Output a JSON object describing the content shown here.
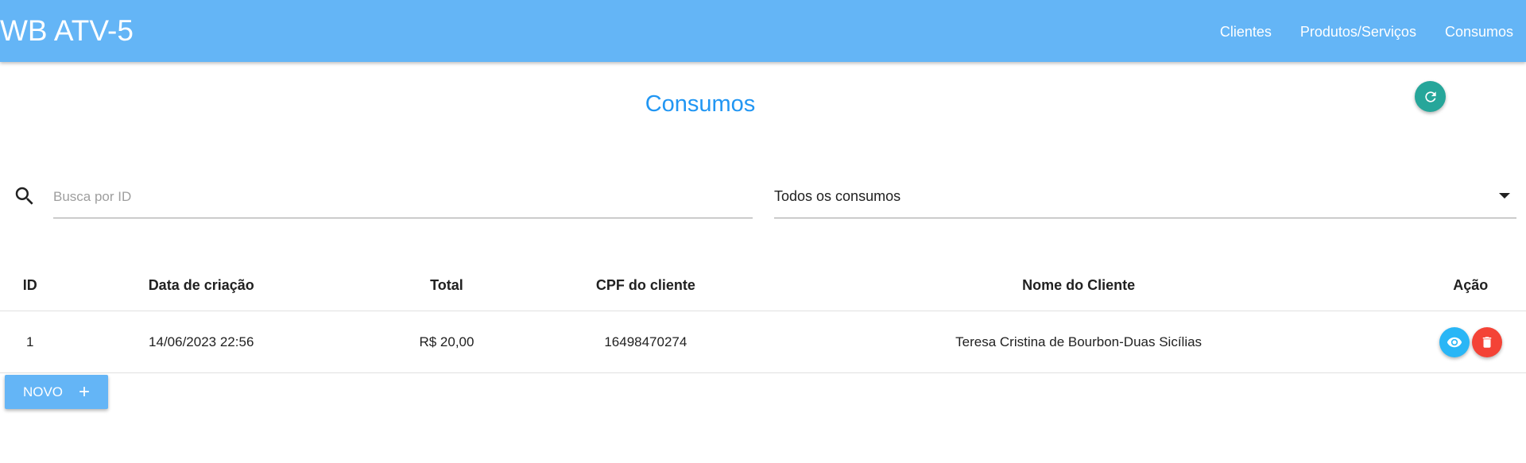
{
  "app": {
    "title": "WB ATV-5"
  },
  "nav": {
    "items": [
      {
        "label": "Clientes"
      },
      {
        "label": "Produtos/Serviços"
      },
      {
        "label": "Consumos"
      }
    ]
  },
  "page": {
    "title": "Consumos"
  },
  "search": {
    "placeholder": "Busca por ID",
    "value": ""
  },
  "filter": {
    "selected": "Todos os consumos"
  },
  "table": {
    "columns": [
      "ID",
      "Data de criação",
      "Total",
      "CPF do cliente",
      "Nome do Cliente",
      "Ação"
    ],
    "rows": [
      {
        "id": "1",
        "date": "14/06/2023 22:56",
        "total": "R$ 20,00",
        "cpf": "16498470274",
        "name": "Teresa Cristina de Bourbon-Duas Sicílias"
      }
    ]
  },
  "new_button": {
    "label": "NOVO",
    "icon": "plus-icon"
  },
  "icons": {
    "refresh": "refresh-icon",
    "search": "search-icon",
    "dropdown": "chevron-down-icon",
    "view": "eye-icon",
    "delete": "trash-icon"
  },
  "colors": {
    "appbar": "#64b5f6",
    "title": "#2196f3",
    "refresh": "#26a69a",
    "view": "#29b6f6",
    "delete": "#f44336",
    "new_button": "#64b5f6"
  }
}
